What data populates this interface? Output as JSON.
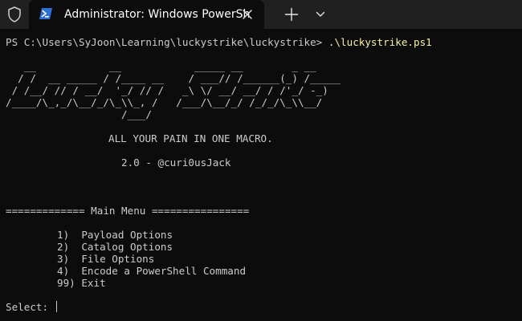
{
  "tab": {
    "title": "Administrator: Windows PowerShell"
  },
  "terminal": {
    "prompt": "PS C:\\Users\\SyJoon\\Learning\\luckystrike\\luckystrike> ",
    "command": ".\\luckystrike.ps1",
    "banner": [
      "   __            __            _____ __        _ __",
      "  / /  __ _____ / /____ __    / ___// /______(_) /_____",
      " / /__/ // / __/  '_/ // /   _\\ \\/ __/ __/ / /'_/ -_)",
      "/____/\\_,_/\\__/_/\\_\\\\_, /   /___/\\__/_/ /_/_/\\_\\\\__/",
      "                   /___/"
    ],
    "tagline": "ALL YOUR PAIN IN ONE MACRO.",
    "version": "2.0 - @curi0usJack",
    "menu_header": "============= Main Menu ================",
    "menu_items": [
      "1)  Payload Options",
      "2)  Catalog Options",
      "3)  File Options",
      "4)  Encode a PowerShell Command",
      "99) Exit"
    ],
    "select_prompt": "Select: "
  },
  "colors": {
    "background": "#0c0c0c",
    "tabbar": "#202020",
    "text": "#cccccc",
    "command": "#f9f1a5",
    "powershell_icon": "#2d6fd6"
  }
}
